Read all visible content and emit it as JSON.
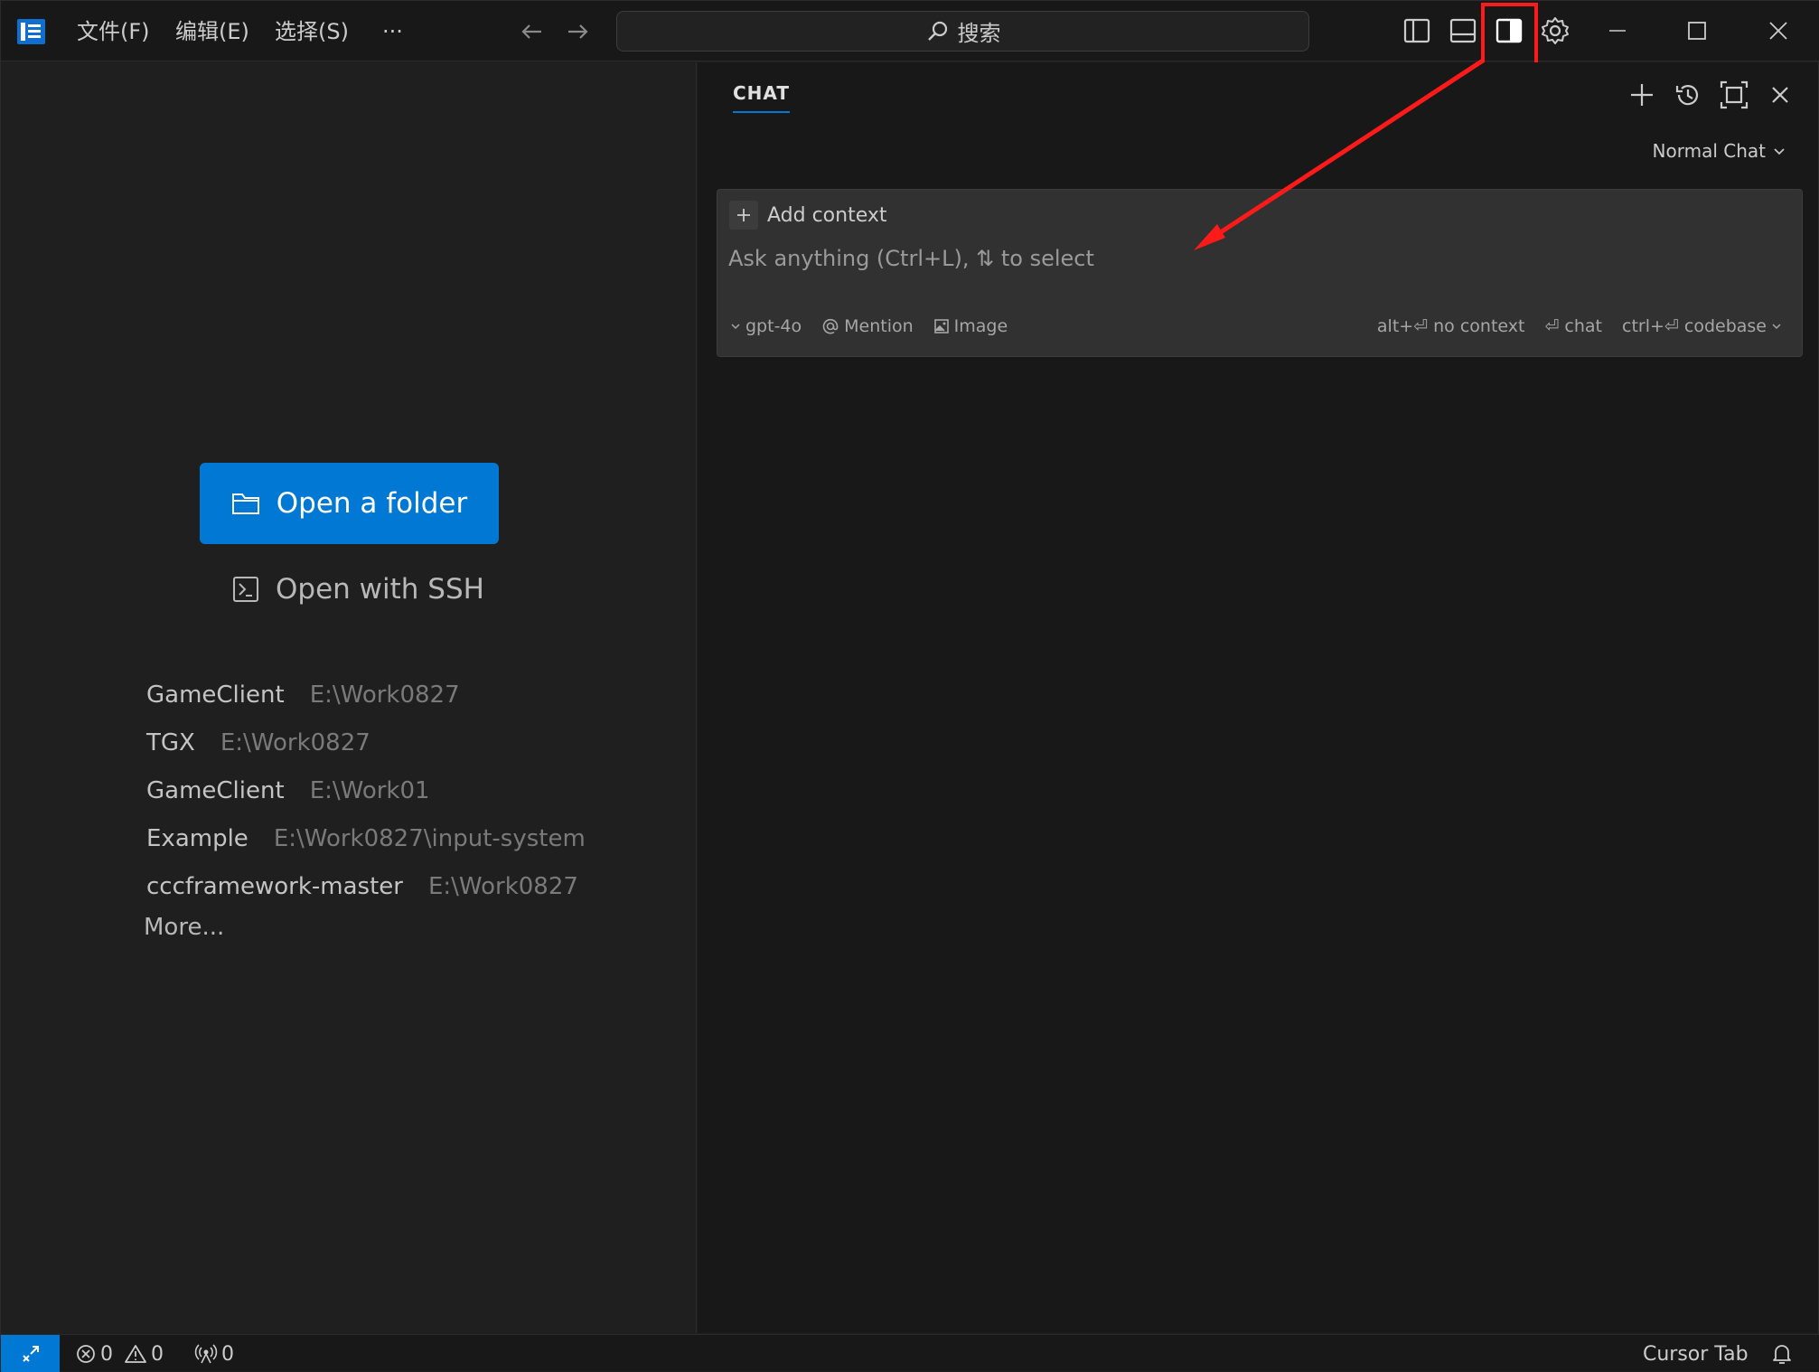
{
  "menu": {
    "file": "文件(F)",
    "edit": "编辑(E)",
    "select": "选择(S)",
    "more": "···"
  },
  "search": {
    "label": "搜索"
  },
  "welcome": {
    "open_folder": "Open a folder",
    "open_ssh": "Open with SSH",
    "recent": [
      {
        "name": "GameClient",
        "path": "E:\\Work0827"
      },
      {
        "name": "TGX",
        "path": "E:\\Work0827"
      },
      {
        "name": "GameClient",
        "path": "E:\\Work01"
      },
      {
        "name": "Example",
        "path": "E:\\Work0827\\input-system"
      },
      {
        "name": "cccframework-master",
        "path": "E:\\Work0827"
      }
    ],
    "more": "More..."
  },
  "chat": {
    "tab": "CHAT",
    "mode": "Normal Chat",
    "add_context": "Add context",
    "placeholder": "Ask anything (Ctrl+L), ⇅ to select",
    "model": "gpt-4o",
    "mention": "Mention",
    "image": "Image",
    "no_context": "alt+⏎ no context",
    "chat_shortcut": "⏎ chat",
    "codebase": "ctrl+⏎ codebase"
  },
  "status": {
    "errors": "0",
    "warnings": "0",
    "ports": "0",
    "cursor_tab": "Cursor Tab"
  },
  "colors": {
    "accent": "#0078d4",
    "annotation": "#ff1a1a"
  }
}
